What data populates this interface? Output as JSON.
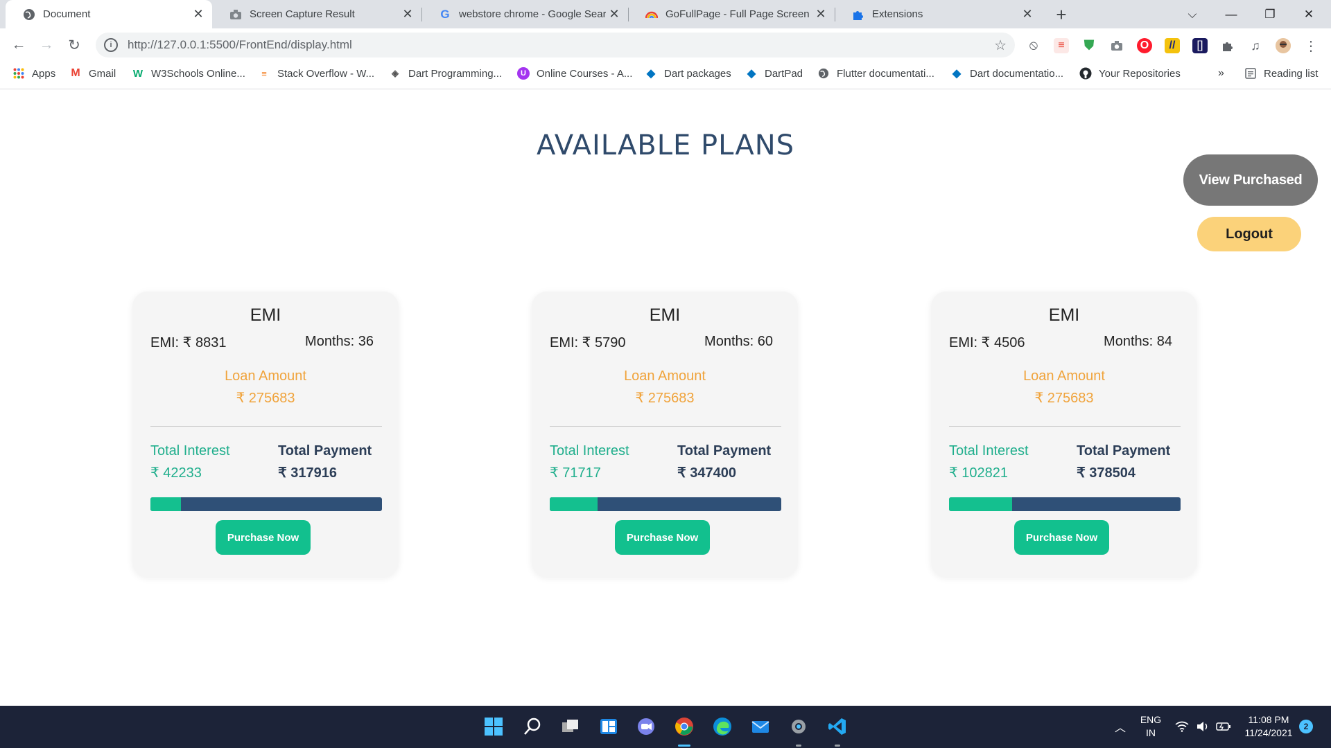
{
  "browser": {
    "tabs": [
      {
        "title": "Document",
        "icon": "globe-icon",
        "active": true
      },
      {
        "title": "Screen Capture Result",
        "icon": "camera-icon",
        "active": false
      },
      {
        "title": "webstore chrome - Google Search",
        "icon": "google-icon",
        "active": false
      },
      {
        "title": "GoFullPage - Full Page Screen Capture",
        "icon": "rainbow-icon",
        "active": false
      },
      {
        "title": "Extensions",
        "icon": "puzzle-icon",
        "active": false
      }
    ],
    "url": "http://127.0.0.1:5500/FrontEnd/display.html",
    "bookmarks": [
      {
        "label": "Apps",
        "icon": "apps-grid-icon"
      },
      {
        "label": "Gmail",
        "icon": "gmail-icon"
      },
      {
        "label": "W3Schools Online...",
        "icon": "w3schools-icon"
      },
      {
        "label": "Stack Overflow - W...",
        "icon": "stackoverflow-icon"
      },
      {
        "label": "Dart Programming...",
        "icon": "dart-diamond-icon"
      },
      {
        "label": "Online Courses - A...",
        "icon": "udemy-icon"
      },
      {
        "label": "Dart packages",
        "icon": "dart-icon"
      },
      {
        "label": "DartPad",
        "icon": "dart-icon"
      },
      {
        "label": "Flutter documentati...",
        "icon": "globe-icon"
      },
      {
        "label": "Dart documentatio...",
        "icon": "dart-icon"
      },
      {
        "label": "Your Repositories",
        "icon": "github-icon"
      }
    ],
    "bookmarks_overflow": "»",
    "reading_list": "Reading list"
  },
  "page": {
    "heading": "AVAILABLE PLANS",
    "view_purchased": "View Purchased",
    "logout": "Logout",
    "plans": [
      {
        "title": "EMI",
        "emi_text": "EMI: ₹ 8831",
        "months_text": "Months: 36",
        "loan_label": "Loan Amount",
        "loan_value": "₹ 275683",
        "interest_label": "Total Interest",
        "interest_value": "₹ 42233",
        "payment_label": "Total Payment",
        "payment_value": "₹ 317916",
        "interest_fraction": 0.133,
        "button": "Purchase Now"
      },
      {
        "title": "EMI",
        "emi_text": "EMI: ₹ 5790",
        "months_text": "Months: 60",
        "loan_label": "Loan Amount",
        "loan_value": "₹ 275683",
        "interest_label": "Total Interest",
        "interest_value": "₹ 71717",
        "payment_label": "Total Payment",
        "payment_value": "₹ 347400",
        "interest_fraction": 0.206,
        "button": "Purchase Now"
      },
      {
        "title": "EMI",
        "emi_text": "EMI: ₹ 4506",
        "months_text": "Months: 84",
        "loan_label": "Loan Amount",
        "loan_value": "₹ 275683",
        "interest_label": "Total Interest",
        "interest_value": "₹ 102821",
        "payment_label": "Total Payment",
        "payment_value": "₹ 378504",
        "interest_fraction": 0.272,
        "button": "Purchase Now"
      }
    ]
  },
  "taskbar": {
    "apps": [
      "windows-start-icon",
      "search-icon",
      "task-view-icon",
      "widgets-icon",
      "teams-chat-icon",
      "chrome-icon",
      "edge-icon",
      "mail-icon",
      "settings-icon",
      "vscode-icon"
    ],
    "language_line1": "ENG",
    "language_line2": "IN",
    "time": "11:08 PM",
    "date": "11/24/2021",
    "notification_count": "2"
  },
  "colors": {
    "heading": "#2f4a6b",
    "accent_green": "#12c08e",
    "loan_orange": "#f0a33b",
    "bar_navy": "#2f5077",
    "view_button": "#777777",
    "logout_button": "#fbd27a",
    "taskbar": "#1c2338"
  }
}
